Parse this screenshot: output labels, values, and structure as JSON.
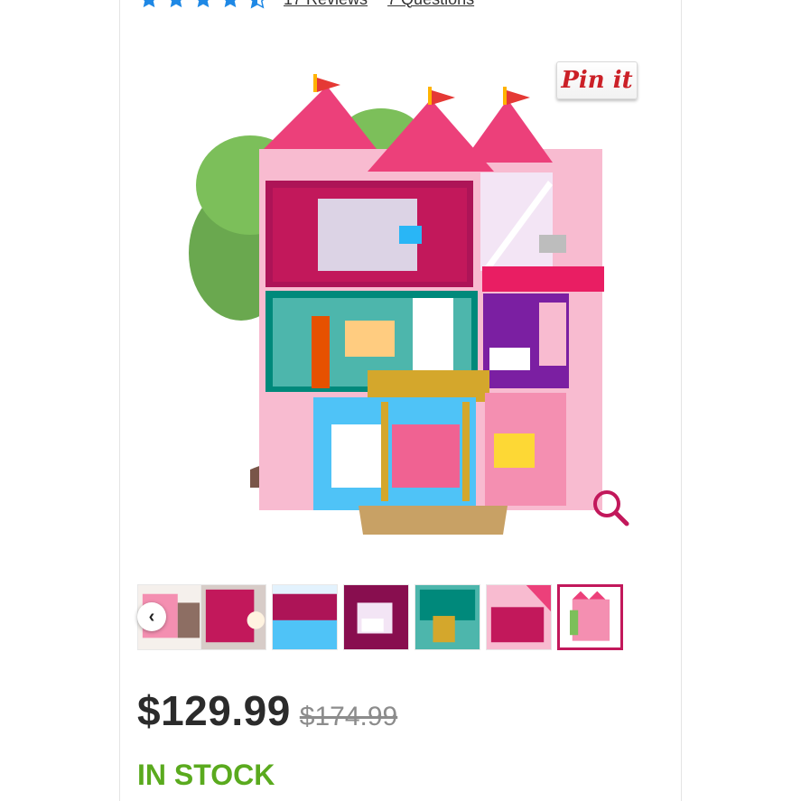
{
  "rating": {
    "stars": 4.5,
    "reviews_text": "17 Reviews",
    "questions_text": "7 Questions",
    "star_color": "#1e88e5"
  },
  "gallery": {
    "pin_label": "Pin it",
    "zoom_icon": "magnifier-icon",
    "prev_icon": "chevron-left-icon",
    "prev_glyph": "‹",
    "accent_color": "#c2185b",
    "thumbnails": [
      {
        "name": "thumb-1"
      },
      {
        "name": "thumb-2"
      },
      {
        "name": "thumb-3"
      },
      {
        "name": "thumb-4"
      },
      {
        "name": "thumb-5"
      },
      {
        "name": "thumb-6"
      },
      {
        "name": "thumb-7",
        "selected": true
      }
    ]
  },
  "pricing": {
    "price": "$129.99",
    "original_price": "$174.99"
  },
  "availability": {
    "status": "IN STOCK",
    "color": "#5aaa1e"
  }
}
